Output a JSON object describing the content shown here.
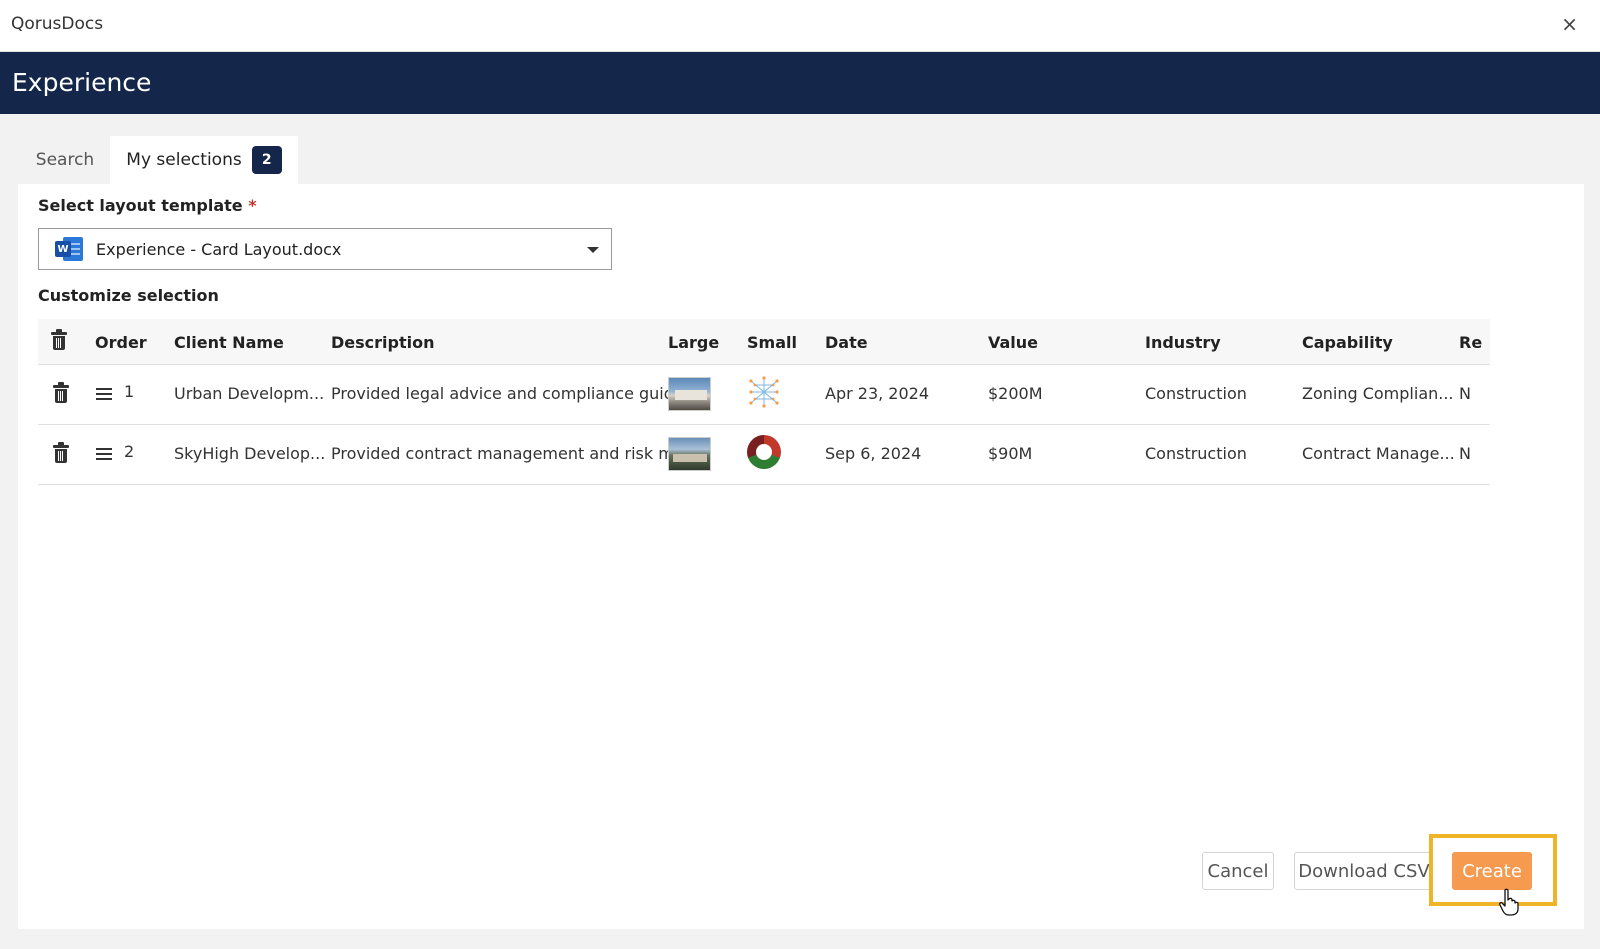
{
  "window": {
    "app_name": "QorusDocs",
    "close_glyph": "×"
  },
  "header": {
    "title": "Experience"
  },
  "tabs": [
    {
      "label": "Search",
      "active": false
    },
    {
      "label": "My selections",
      "badge": "2",
      "active": true
    }
  ],
  "layout_template": {
    "label": "Select layout template",
    "required_mark": "*",
    "selected_value": "Experience - Card Layout.docx",
    "icon": "word-doc-icon",
    "icon_letter": "W"
  },
  "customize": {
    "label": "Customize selection"
  },
  "table": {
    "columns": [
      "Order",
      "Client Name",
      "Description",
      "Large",
      "Small",
      "Date",
      "Value",
      "Industry",
      "Capability",
      "Re"
    ],
    "rows": [
      {
        "order": "1",
        "client_name": "Urban Developm...",
        "description": "Provided legal advice and compliance guida...",
        "large_thumb": "building-photo-thumbnail",
        "small_thumb": "network-graphic-thumbnail",
        "date": "Apr 23, 2024",
        "value": "$200M",
        "industry": "Construction",
        "capability": "Zoning Complian...",
        "re": "N"
      },
      {
        "order": "2",
        "client_name": "SkyHigh Develop...",
        "description": "Provided contract management and risk mit...",
        "large_thumb": "mountain-village-thumbnail",
        "small_thumb": "ring-logo-thumbnail",
        "date": "Sep 6, 2024",
        "value": "$90M",
        "industry": "Construction",
        "capability": "Contract Manage...",
        "re": "N"
      }
    ]
  },
  "actions": {
    "cancel": "Cancel",
    "download_csv": "Download CSV",
    "create": "Create"
  },
  "colors": {
    "header_bg": "#14264a",
    "create_btn": "#f59a4f",
    "highlight_border": "#f0b429"
  }
}
